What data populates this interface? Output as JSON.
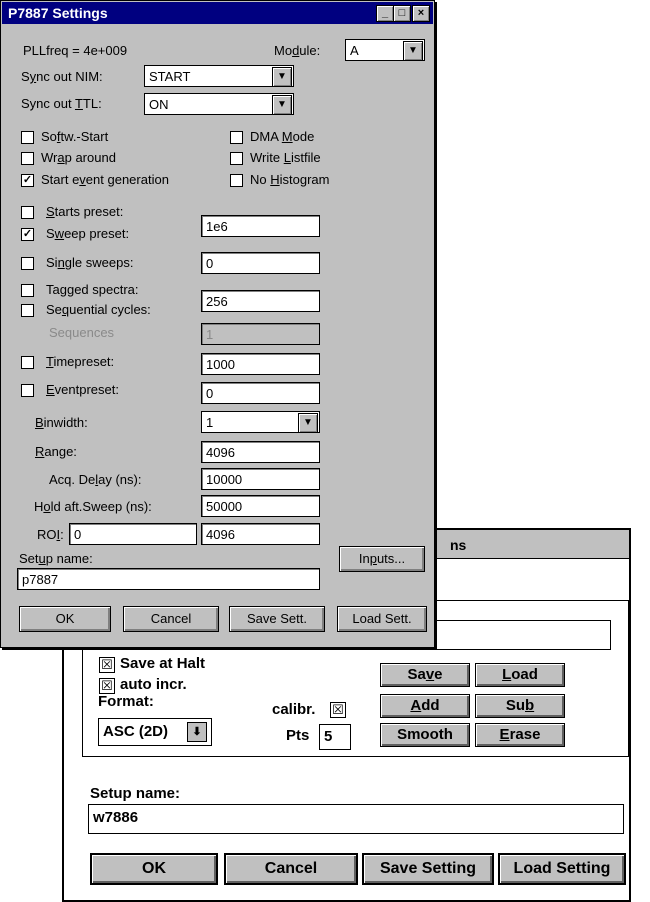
{
  "front": {
    "title": "P7887 Settings",
    "window_buttons": {
      "minimize": "_",
      "maximize": "□",
      "close": "×"
    },
    "pllfreq": "PLLfreq = 4e+009",
    "module_label_a": "Mo",
    "module_label_u": "d",
    "module_label_b": "ule:",
    "module_value": "A",
    "sync_nim_label_a": "S",
    "sync_nim_label_u": "y",
    "sync_nim_label_b": "nc out NIM:",
    "sync_nim_value": "START",
    "sync_ttl_label_a": "Sync out ",
    "sync_ttl_label_u": "T",
    "sync_ttl_label_b": "TL:",
    "sync_ttl_value": "ON",
    "checks": {
      "softw_start": {
        "a": "So",
        "u": "f",
        "b": "tw.-Start",
        "checked": ""
      },
      "dma_mode": {
        "a": "DMA ",
        "u": "M",
        "b": "ode",
        "checked": ""
      },
      "wrap_around": {
        "a": "Wr",
        "u": "a",
        "b": "p around",
        "checked": ""
      },
      "write_listfile": {
        "a": "Write ",
        "u": "L",
        "b": "istfile",
        "checked": ""
      },
      "start_event": {
        "a": "Start e",
        "u": "v",
        "b": "ent generation",
        "checked": "✓"
      },
      "no_histogram": {
        "a": "No ",
        "u": "H",
        "b": "istogram",
        "checked": ""
      },
      "starts_preset": {
        "a": "",
        "u": "S",
        "b": "tarts preset:",
        "checked": ""
      },
      "sweep_preset": {
        "a": "S",
        "u": "w",
        "b": "eep preset:",
        "checked": "✓"
      },
      "single_sweeps": {
        "a": "Si",
        "u": "n",
        "b": "gle sweeps:",
        "checked": ""
      },
      "tagged_spectra": {
        "a": "Tagged spectra:",
        "u": "",
        "b": "",
        "checked": ""
      },
      "sequential_cycles": {
        "a": "Se",
        "u": "q",
        "b": "uential cycles:",
        "checked": ""
      },
      "timepreset": {
        "a": "",
        "u": "T",
        "b": "imepreset:",
        "checked": ""
      },
      "eventpreset": {
        "a": "",
        "u": "E",
        "b": "ventpreset:",
        "checked": ""
      }
    },
    "sweep_preset_value": "1e6",
    "single_sweeps_value": "0",
    "sequential_cycles_value": "256",
    "sequences_label": "Sequences",
    "sequences_value": "1",
    "timepreset_value": "1000",
    "eventpreset_value": "0",
    "binwidth_label": {
      "a": "",
      "u": "B",
      "b": "inwidth:"
    },
    "binwidth_value": "1",
    "range_label": {
      "a": "",
      "u": "R",
      "b": "ange:"
    },
    "range_value": "4096",
    "acq_delay_label": {
      "a": "Acq. De",
      "u": "l",
      "b": "ay (ns):"
    },
    "acq_delay_value": "10000",
    "hold_label": {
      "a": "H",
      "u": "o",
      "b": "ld aft.Sweep (ns):"
    },
    "hold_value": "50000",
    "roi_label": {
      "a": "RO",
      "u": "I",
      "b": ":"
    },
    "roi_from": "0",
    "roi_to": "4096",
    "inputs_button": {
      "a": "In",
      "u": "p",
      "b": "uts..."
    },
    "setup_name_label": {
      "a": "Set",
      "u": "u",
      "b": "p name:"
    },
    "setup_name_value": "p7887",
    "ok": "OK",
    "cancel": "Cancel",
    "save_sett": "Save Sett.",
    "load_sett": "Load Sett."
  },
  "back": {
    "title_fragment": "ns",
    "save_at_halt": "Save at Halt",
    "save_at_halt_checked": "☒",
    "auto_incr": "auto incr.",
    "auto_incr_checked": "☒",
    "format_label": "Format:",
    "format_value": "ASC (2D)",
    "calibr_label": "calibr.",
    "calibr_checked": "☒",
    "pts_label": "Pts",
    "pts_value": "5",
    "save_btn": {
      "a": "Sa",
      "u": "v",
      "b": "e"
    },
    "load_btn": {
      "a": "",
      "u": "L",
      "b": "oad"
    },
    "add_btn": {
      "a": "",
      "u": "A",
      "b": "dd"
    },
    "sub_btn": {
      "a": "Su",
      "u": "b",
      "b": ""
    },
    "smooth_btn": "Smooth",
    "erase_btn": {
      "a": "",
      "u": "E",
      "b": "rase"
    },
    "setup_name_label": "Setup name:",
    "setup_name_value": "w7886",
    "ok": "OK",
    "cancel": "Cancel",
    "save_setting": "Save Setting",
    "load_setting": "Load Setting"
  }
}
